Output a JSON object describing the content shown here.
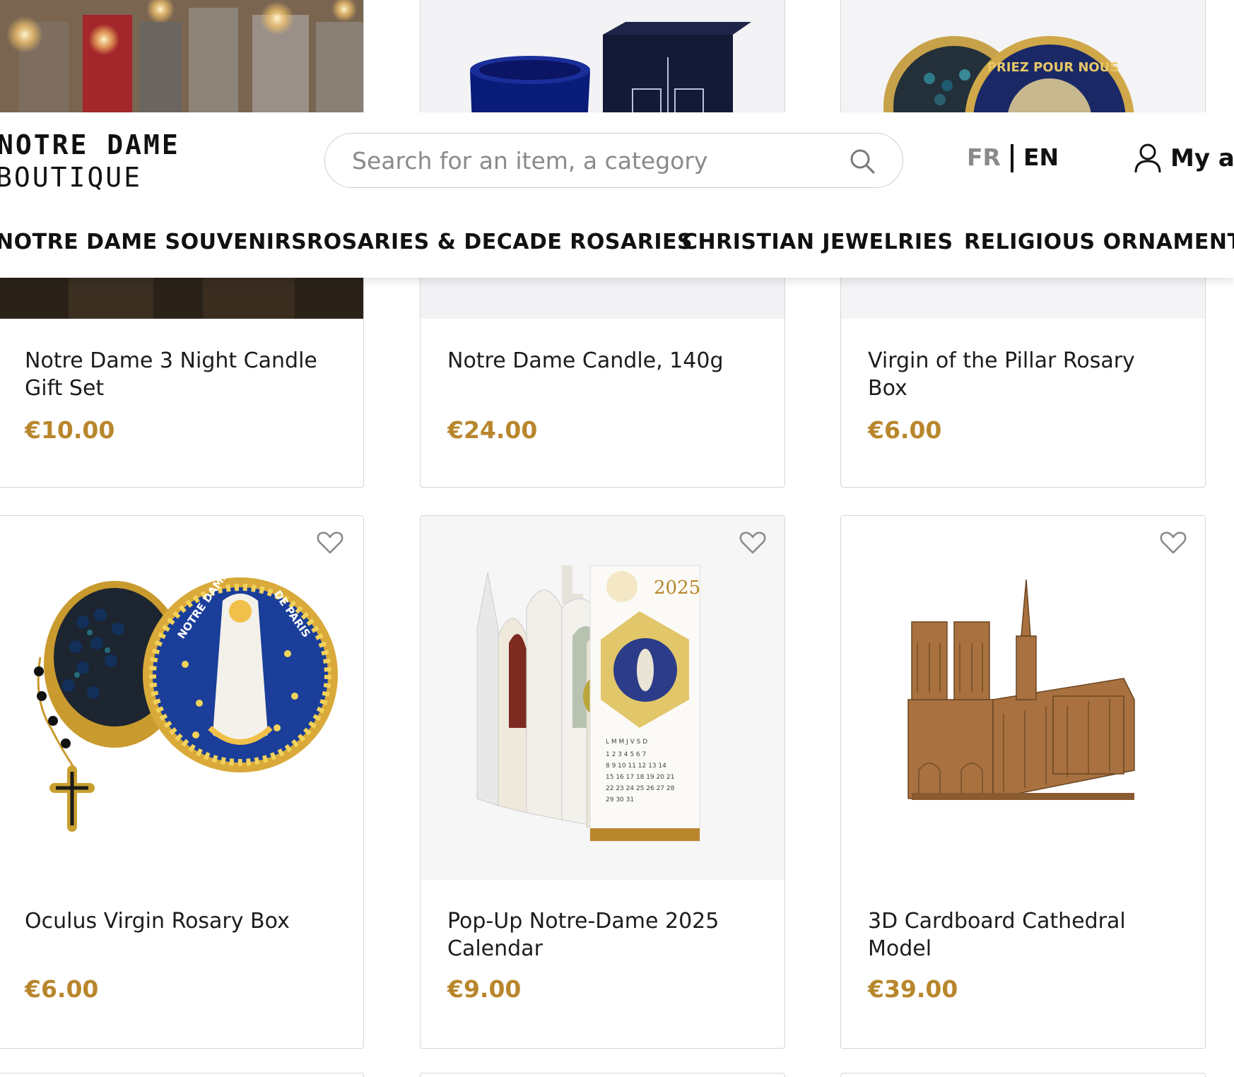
{
  "header": {
    "logo_line1": "NOTRE DAME",
    "logo_line2": "BOUTIQUE",
    "search_placeholder": "Search for an item, a category",
    "lang_fr": "FR",
    "lang_en": "EN",
    "account_label": "My ac"
  },
  "nav": {
    "items": [
      {
        "label": "NOTRE DAME SOUVENIRS"
      },
      {
        "label": "ROSARIES & DECADE ROSARIES"
      },
      {
        "label": "CHRISTIAN JEWELRIES"
      },
      {
        "label": "RELIGIOUS ORNAMENTS"
      }
    ]
  },
  "products": [
    {
      "name": "Notre Dame 3 Night Candle Gift Set",
      "price": "€10.00"
    },
    {
      "name": "Notre Dame Candle, 140g",
      "price": "€24.00"
    },
    {
      "name": "Virgin of the Pillar Rosary Box",
      "price": "€6.00"
    },
    {
      "name": "Oculus Virgin Rosary Box",
      "price": "€6.00"
    },
    {
      "name": "Pop-Up Notre-Dame 2025 Calendar",
      "price": "€9.00"
    },
    {
      "name": "3D Cardboard Cathedral Model",
      "price": "€39.00"
    }
  ],
  "images": {
    "box_lid_text": "PRIEZ POUR NOUS",
    "rosary_lid_text_1": "NOTRE DAME",
    "rosary_lid_text_2": "DE PARIS",
    "calendar_year": "2025"
  },
  "colors": {
    "price": "#b8862c",
    "text": "#1c1c1c",
    "border": "#d6d6d6",
    "muted": "#8a8a8a"
  }
}
